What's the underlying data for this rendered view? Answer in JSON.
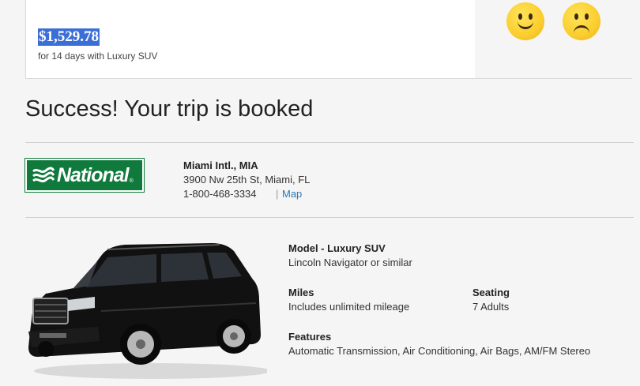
{
  "price": {
    "amount": "$1,529.78",
    "subtitle": "for 14 days with Luxury SUV"
  },
  "feedback": {
    "happy_icon": "happy-face-icon",
    "sad_icon": "sad-face-icon",
    "face_color": "#fbcd2e"
  },
  "heading": "Success! Your trip is booked",
  "vendor": {
    "logo_text": "National",
    "logo_mark": "®",
    "logo_color": "#0f7a3c"
  },
  "location": {
    "name": "Miami Intl., MIA",
    "address": "3900 Nw 25th St, Miami, FL",
    "phone": "1-800-468-3334",
    "separator": "|",
    "map_link": "Map"
  },
  "car": {
    "model_label": "Model - Luxury SUV",
    "model_value": "Lincoln Navigator or similar",
    "miles_label": "Miles",
    "miles_value": "Includes unlimited mileage",
    "seating_label": "Seating",
    "seating_value": "7 Adults",
    "features_label": "Features",
    "features_value": "Automatic Transmission, Air Conditioning, Air Bags, AM/FM Stereo"
  }
}
